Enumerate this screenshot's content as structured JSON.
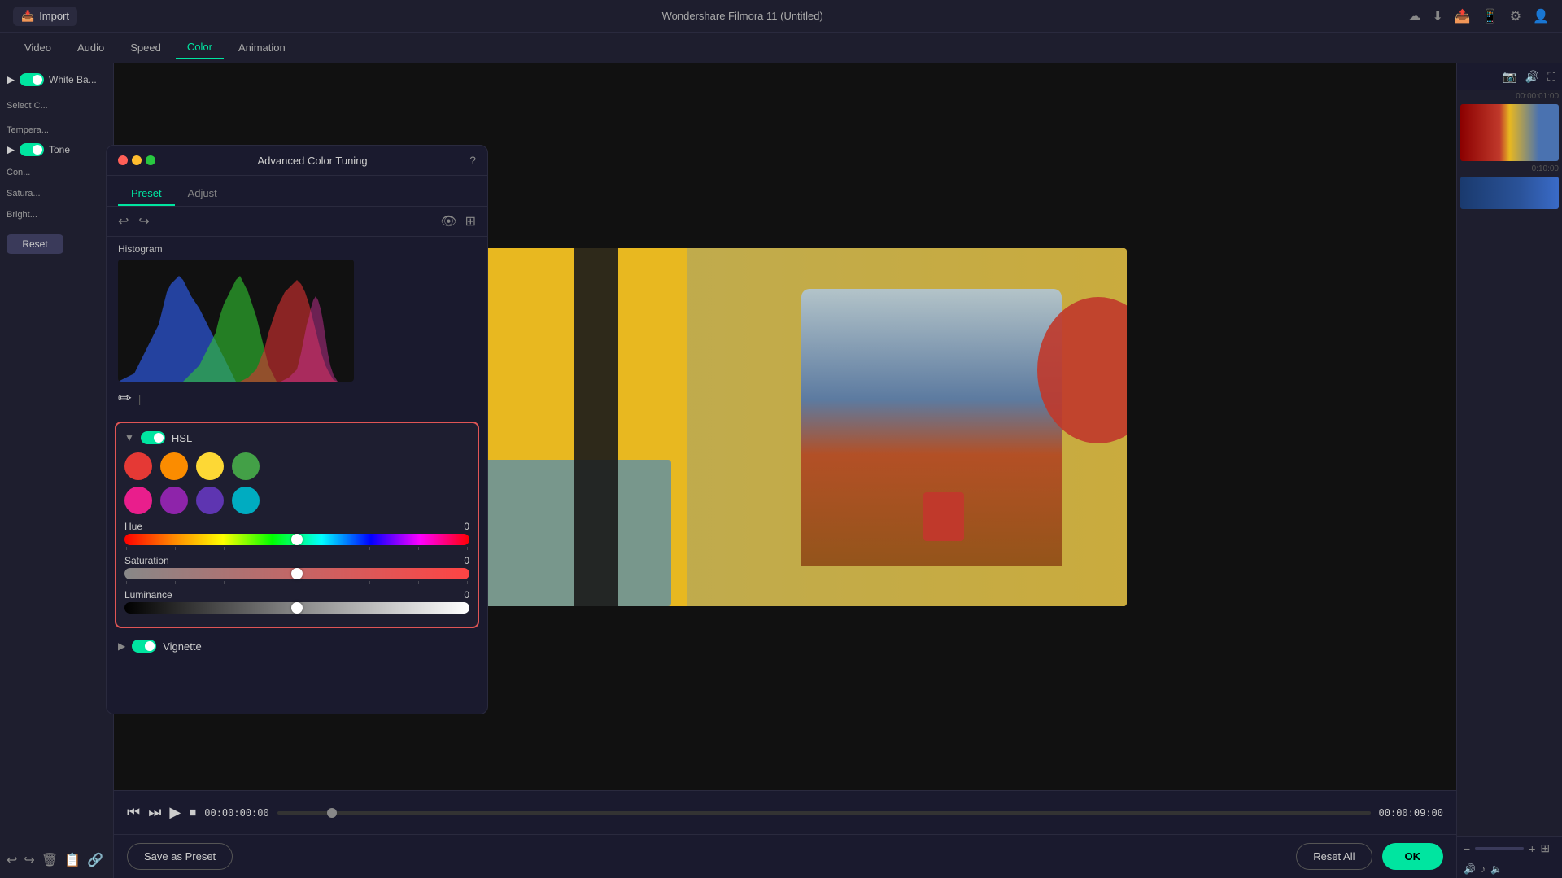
{
  "app": {
    "title": "Wondershare Filmora 11 (Untitled)"
  },
  "top_bar": {
    "import_label": "Import",
    "icons": [
      "cloud-upload",
      "cloud-download",
      "bell",
      "phone",
      "settings",
      "account"
    ]
  },
  "nav_tabs": {
    "tabs": [
      {
        "label": "Video",
        "active": false
      },
      {
        "label": "Audio",
        "active": false
      },
      {
        "label": "Speed",
        "active": false
      },
      {
        "label": "Color",
        "active": true
      },
      {
        "label": "Animation",
        "active": false
      }
    ]
  },
  "left_panel": {
    "white_balance_label": "White Ba...",
    "select_color_label": "Select C...",
    "temperature_label": "Tempera...",
    "tone_label": "Tone",
    "contrast_label": "Con...",
    "saturation_label": "Satura...",
    "brightness_label": "Bright...",
    "reset_label": "Reset"
  },
  "dialog": {
    "title": "Advanced Color Tuning",
    "dots": [
      "red",
      "yellow",
      "green"
    ],
    "tabs": [
      {
        "label": "Preset",
        "active": true
      },
      {
        "label": "Adjust",
        "active": false
      }
    ]
  },
  "histogram": {
    "label": "Histogram"
  },
  "hsl": {
    "title": "HSL",
    "swatches": [
      {
        "color": "#e53935",
        "name": "red"
      },
      {
        "color": "#fb8c00",
        "name": "orange"
      },
      {
        "color": "#fdd835",
        "name": "yellow"
      },
      {
        "color": "#43a047",
        "name": "green"
      },
      {
        "color": "#e91e8c",
        "name": "pink"
      },
      {
        "color": "#8e24aa",
        "name": "purple"
      },
      {
        "color": "#5e35b1",
        "name": "blue-purple"
      },
      {
        "color": "#00acc1",
        "name": "cyan"
      }
    ],
    "sliders": [
      {
        "label": "Hue",
        "value": "0"
      },
      {
        "label": "Saturation",
        "value": "0"
      },
      {
        "label": "Luminance",
        "value": "0"
      }
    ]
  },
  "vignette": {
    "label": "Vignette"
  },
  "transport": {
    "time_current": "00:00:00:00",
    "time_total": "00:00:09:00"
  },
  "bottom_actions": {
    "save_preset_label": "Save as Preset",
    "reset_all_label": "Reset All",
    "ok_label": "OK"
  },
  "timeline": {
    "time_labels": [
      "00:00:01:00",
      "0:10:00"
    ]
  }
}
